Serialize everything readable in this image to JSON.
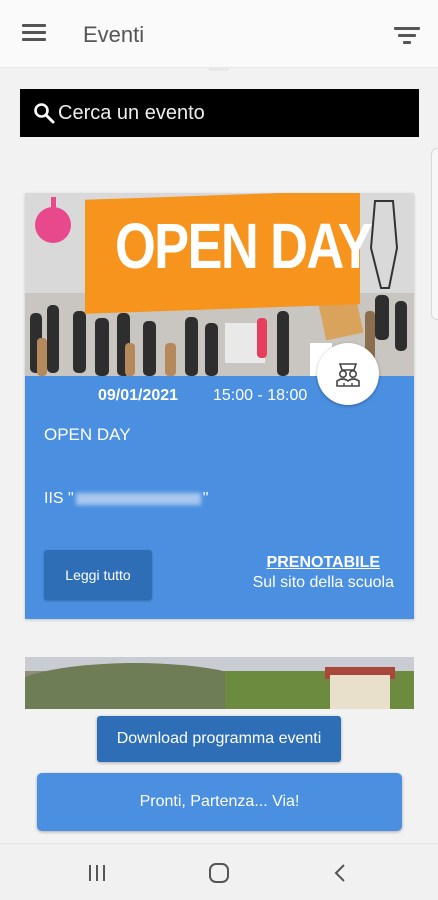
{
  "appbar": {
    "title": "Eventi",
    "menu_icon": "menu-icon",
    "filter_icon": "filter-icon"
  },
  "search": {
    "placeholder": "Cerca un evento",
    "icon": "search-icon"
  },
  "event_card": {
    "banner_text": "OPEN DAY",
    "date": "09/01/2021",
    "time": "15:00 - 18:00",
    "title": "OPEN DAY",
    "school_prefix": "IIS \"",
    "school_suffix": "\"",
    "read_more_label": "Leggi tutto",
    "bookable_label": "PRENOTABILE",
    "bookable_note": "Sul sito della scuola",
    "category_icon": "students-icon",
    "accent_color": "#4a8fe0"
  },
  "buttons": {
    "download_label": "Download programma eventi",
    "go_label": "Pronti, Partenza... Via!"
  },
  "navbar": {
    "recents_icon": "recents-icon",
    "home_icon": "home-icon",
    "back_icon": "back-icon"
  }
}
